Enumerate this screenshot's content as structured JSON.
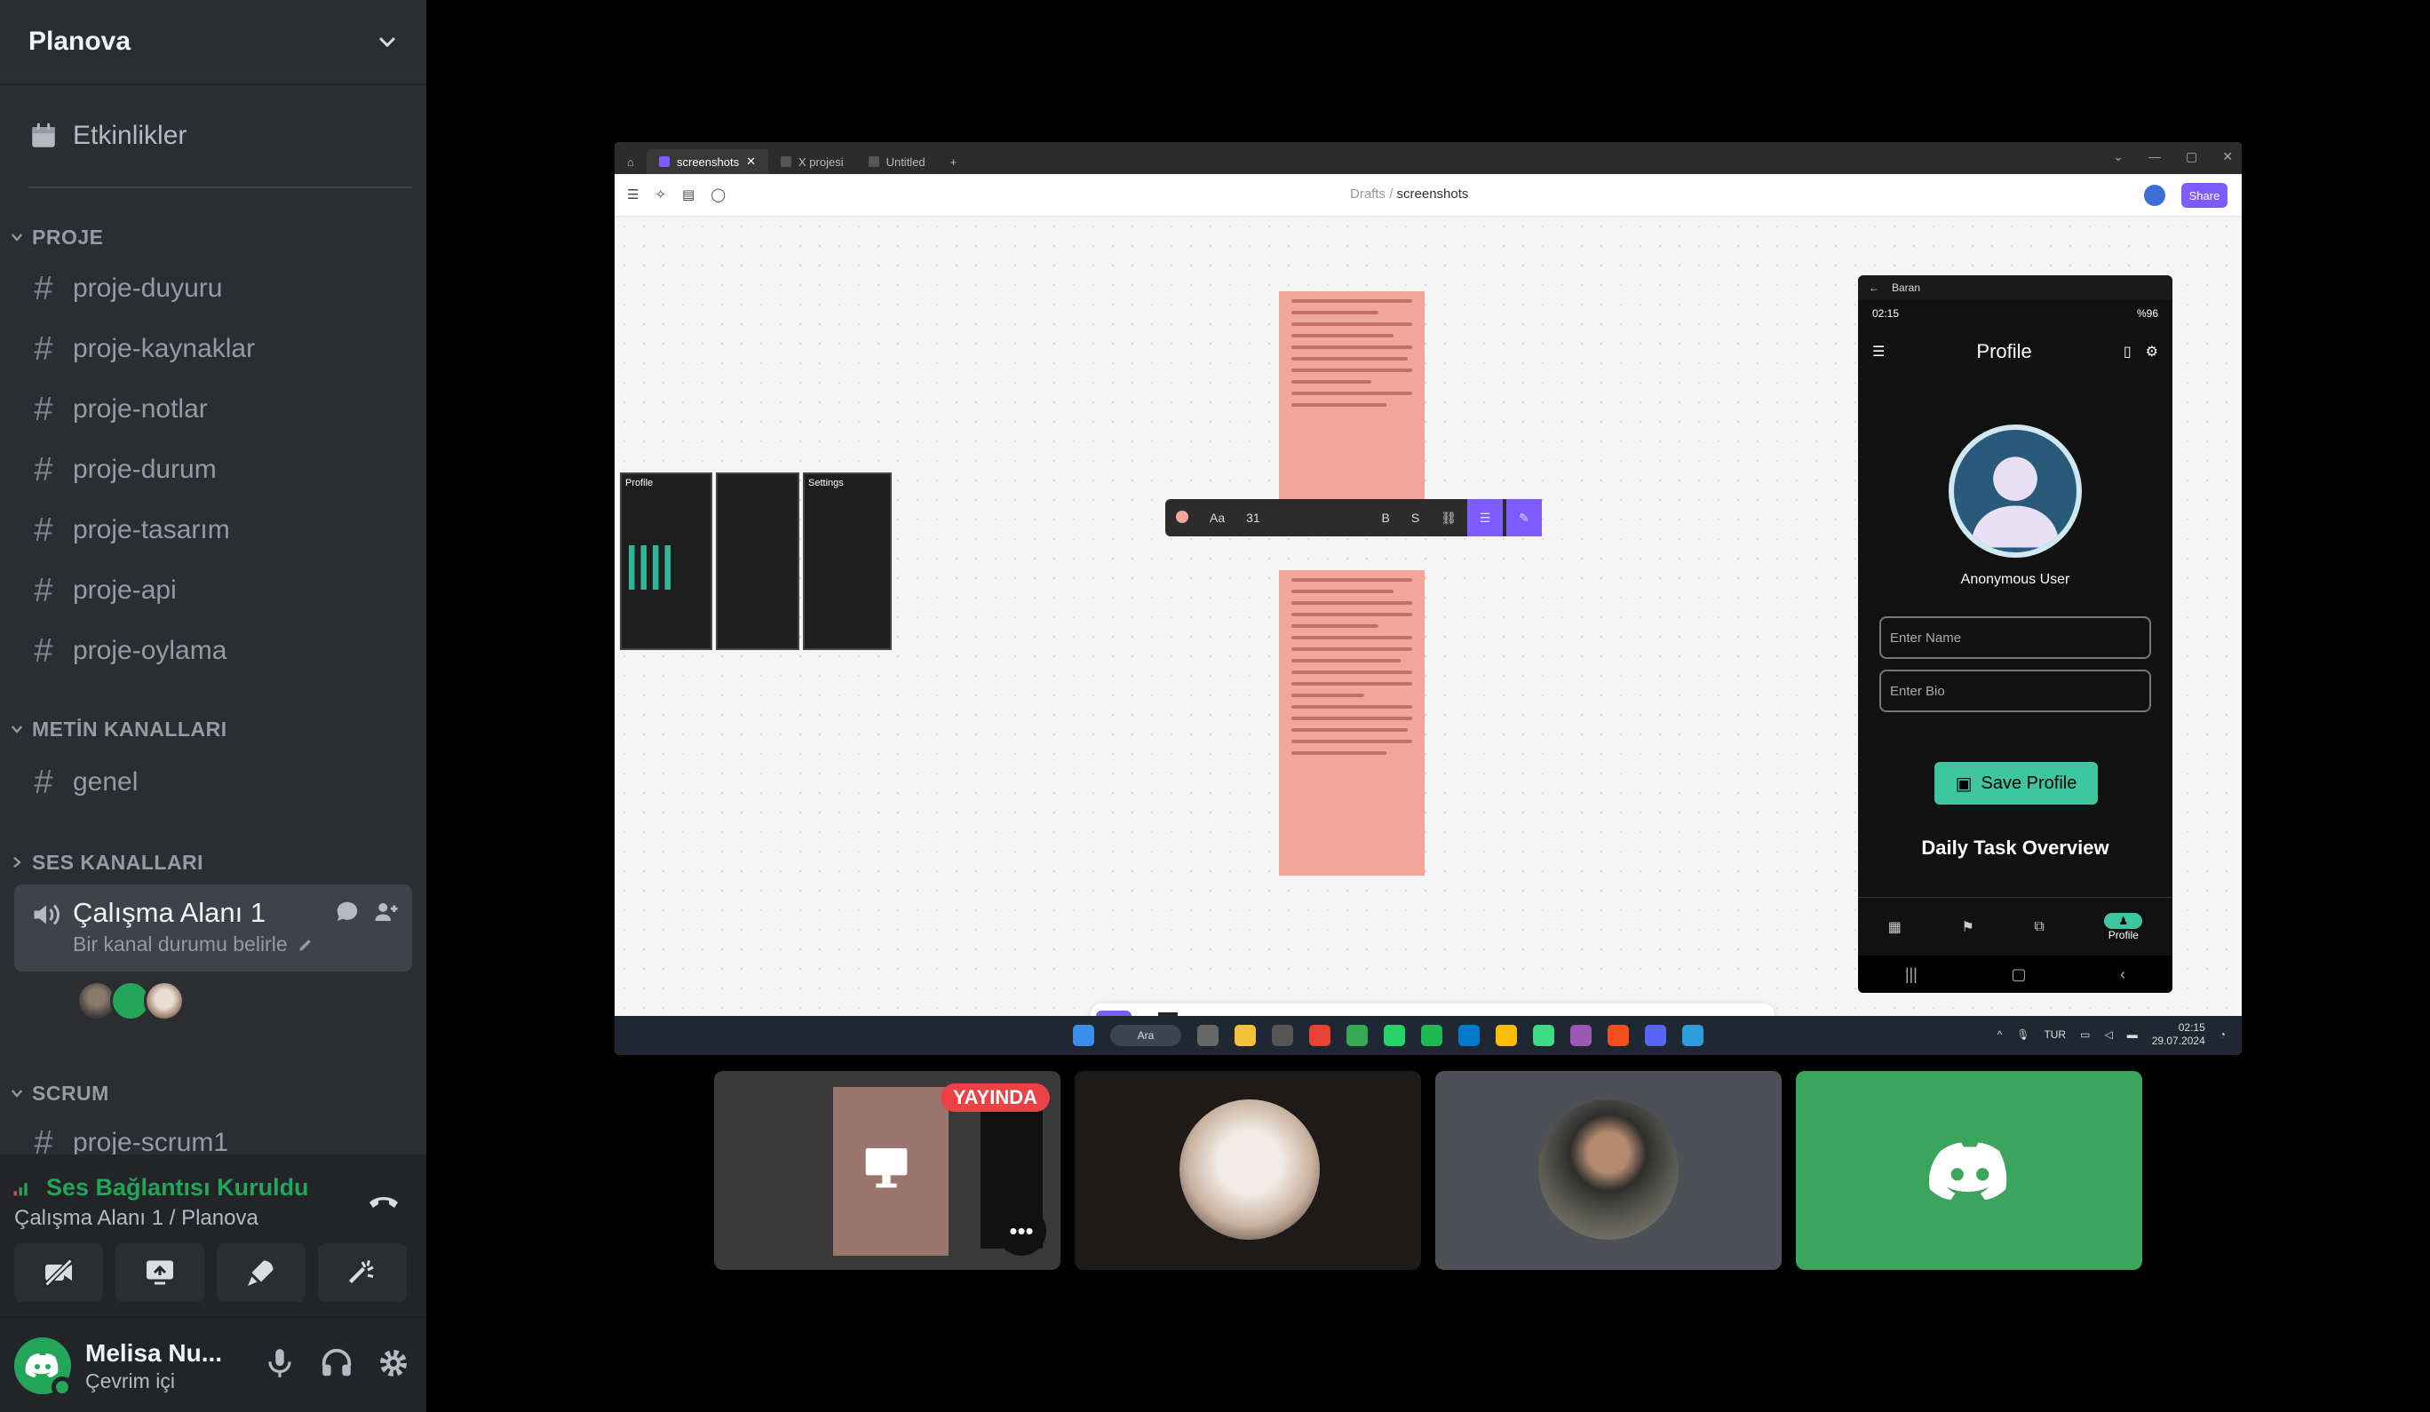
{
  "server": {
    "name": "Planova"
  },
  "events_label": "Etkinlikler",
  "categories": {
    "proje": "PROJE",
    "metin": "METİN KANALLARI",
    "ses": "SES KANALLARI",
    "scrum": "SCRUM"
  },
  "proje_channels": [
    "proje-duyuru",
    "proje-kaynaklar",
    "proje-notlar",
    "proje-durum",
    "proje-tasarım",
    "proje-api",
    "proje-oylama"
  ],
  "metin_channels": [
    "genel"
  ],
  "voice_channel": {
    "name": "Çalışma Alanı 1",
    "status_placeholder": "Bir kanal durumu belirle"
  },
  "scrum_channels": [
    "proje-scrum1"
  ],
  "voice_connection": {
    "status": "Ses Bağlantısı Kuruldu",
    "location": "Çalışma Alanı 1 / Planova"
  },
  "user": {
    "name": "Melisa Nu...",
    "status": "Çevrim içi"
  },
  "stream": {
    "tabs": [
      "screenshots",
      "X projesi",
      "Untitled"
    ],
    "breadcrumb_root": "Drafts",
    "breadcrumb_sep": "/",
    "breadcrumb_file": "screenshots",
    "share_label": "Share",
    "frame_profile_label": "Profile",
    "frame_settings_label": "Settings",
    "text_toolbar": {
      "font": "Aa",
      "size": "31",
      "bold": "B"
    },
    "help_label": "?",
    "phone": {
      "window_title": "Baran",
      "time": "02:15",
      "battery": "%96",
      "title": "Profile",
      "username": "Anonymous User",
      "name_placeholder": "Enter Name",
      "bio_placeholder": "Enter Bio",
      "save_label": "Save Profile",
      "section_title": "Daily Task Overview",
      "nav_active_label": "Profile"
    },
    "taskbar": {
      "search": "Ara",
      "lang": "TUR",
      "time": "02:15",
      "date": "29.07.2024"
    }
  },
  "live_badge": "YAYINDA",
  "colors": {
    "accent": "#5865f2",
    "online": "#23a55a",
    "live": "#ed4245",
    "figma": "#7c5cff"
  }
}
